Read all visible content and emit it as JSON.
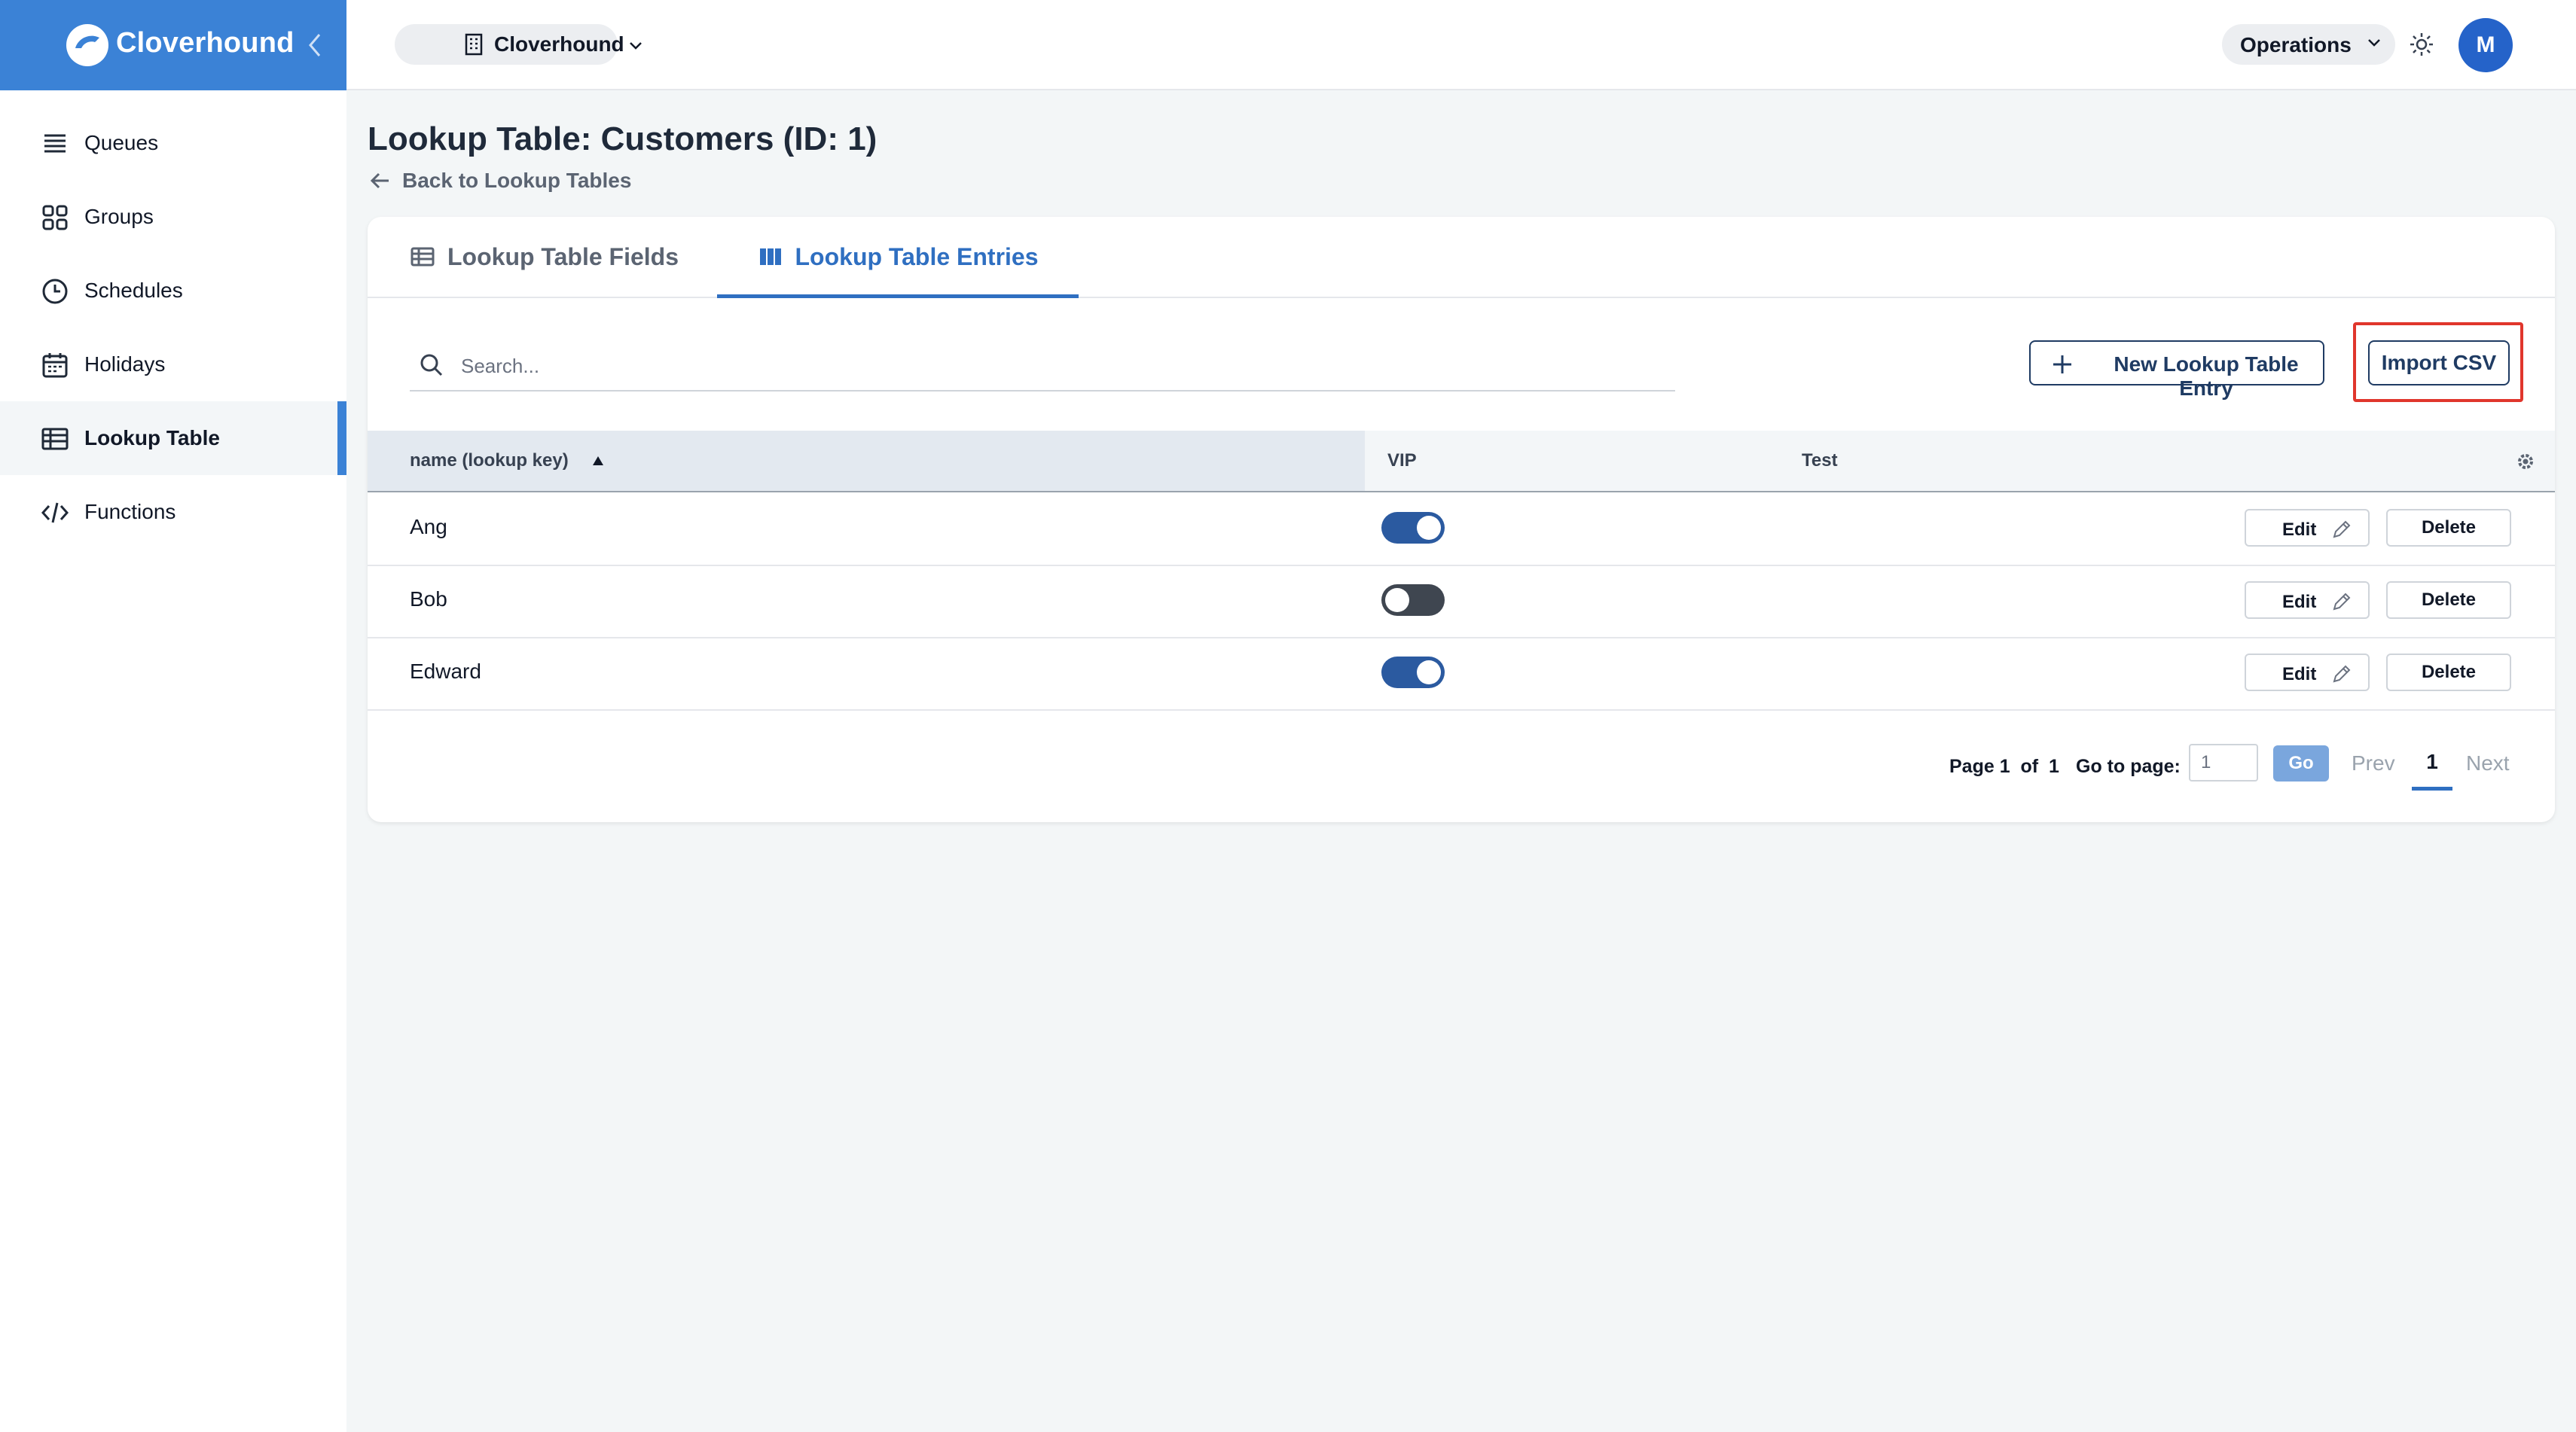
{
  "brand": {
    "name": "Cloverhound"
  },
  "sidebar": {
    "items": [
      {
        "label": "Queues",
        "icon": "list-icon",
        "active": false
      },
      {
        "label": "Groups",
        "icon": "grid-icon",
        "active": false
      },
      {
        "label": "Schedules",
        "icon": "clock-icon",
        "active": false
      },
      {
        "label": "Holidays",
        "icon": "calendar-icon",
        "active": false
      },
      {
        "label": "Lookup Table",
        "icon": "table-icon",
        "active": true
      },
      {
        "label": "Functions",
        "icon": "code-icon",
        "active": false
      }
    ]
  },
  "topbar": {
    "org_label": "Cloverhound",
    "workspace_label": "Operations",
    "avatar_initial": "M"
  },
  "page": {
    "title": "Lookup Table: Customers (ID: 1)",
    "back_link": "Back to Lookup Tables"
  },
  "tabs": [
    {
      "label": "Lookup Table Fields",
      "active": false
    },
    {
      "label": "Lookup Table Entries",
      "active": true
    }
  ],
  "search": {
    "placeholder": "Search..."
  },
  "actions": {
    "new_entry": "New Lookup Table Entry",
    "import_csv": "Import CSV"
  },
  "table": {
    "columns": [
      "name (lookup key)",
      "VIP",
      "Test"
    ],
    "rows": [
      {
        "name": "Ang",
        "vip": true,
        "test": ""
      },
      {
        "name": "Bob",
        "vip": false,
        "test": ""
      },
      {
        "name": "Edward",
        "vip": true,
        "test": ""
      }
    ],
    "edit_label": "Edit",
    "delete_label": "Delete"
  },
  "pagination": {
    "page_text": "Page 1  of  1",
    "goto_label": "Go to page:",
    "goto_value": "1",
    "go_label": "Go",
    "prev_label": "Prev",
    "current_page": "1",
    "next_label": "Next"
  },
  "colors": {
    "accent": "#3b82d6",
    "primary_dark": "#1f3b63",
    "toggle_on": "#2b5aa0",
    "toggle_off": "#3f4650",
    "highlight": "#e0362c"
  }
}
